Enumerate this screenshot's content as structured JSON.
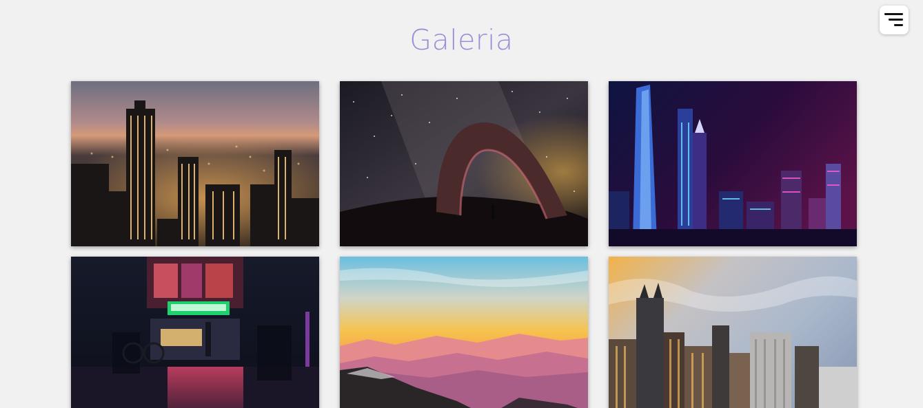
{
  "page": {
    "title": "Galeria"
  },
  "menu": {
    "icon": "menu-icon"
  },
  "gallery": {
    "items": [
      {
        "name": "city-night-aerial-photo",
        "icon": "image"
      },
      {
        "name": "milky-way-arch-photo",
        "icon": "image"
      },
      {
        "name": "skyscrapers-neon-photo",
        "icon": "image"
      },
      {
        "name": "neon-street-night-photo",
        "icon": "image"
      },
      {
        "name": "mountain-sunset-photo",
        "icon": "image"
      },
      {
        "name": "city-skyline-sunset-photo",
        "icon": "image"
      }
    ]
  },
  "colors": {
    "background": "#f1f1f1",
    "title": "#9b8ed8",
    "menu_button": "#ffffff"
  }
}
